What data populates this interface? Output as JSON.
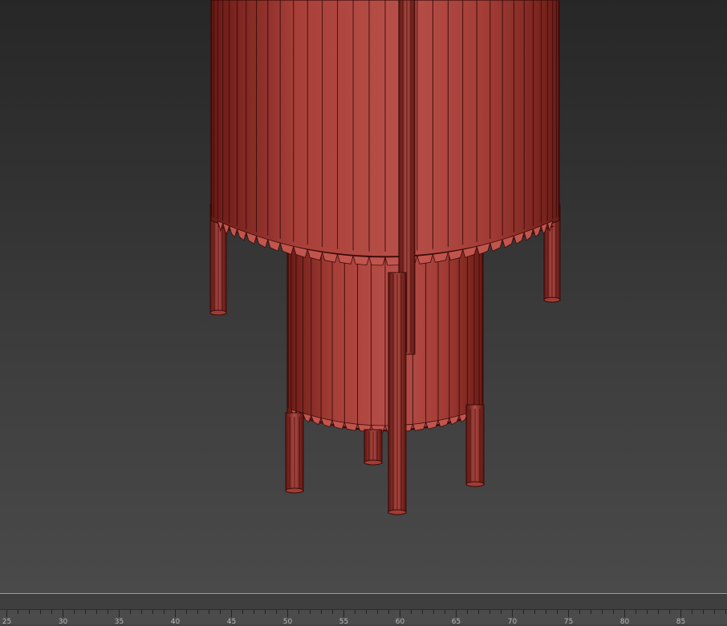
{
  "viewport": {
    "background_top": "#272727",
    "background_bottom": "#4a4a4a",
    "object_color": "#b34b43",
    "edge_color": "#3a0b09"
  },
  "timeline": {
    "ticks": [
      "25",
      "30",
      "35",
      "40",
      "45",
      "50",
      "55",
      "60",
      "65",
      "70",
      "75",
      "80",
      "85"
    ],
    "accent_line_color": "#b7a34a"
  }
}
